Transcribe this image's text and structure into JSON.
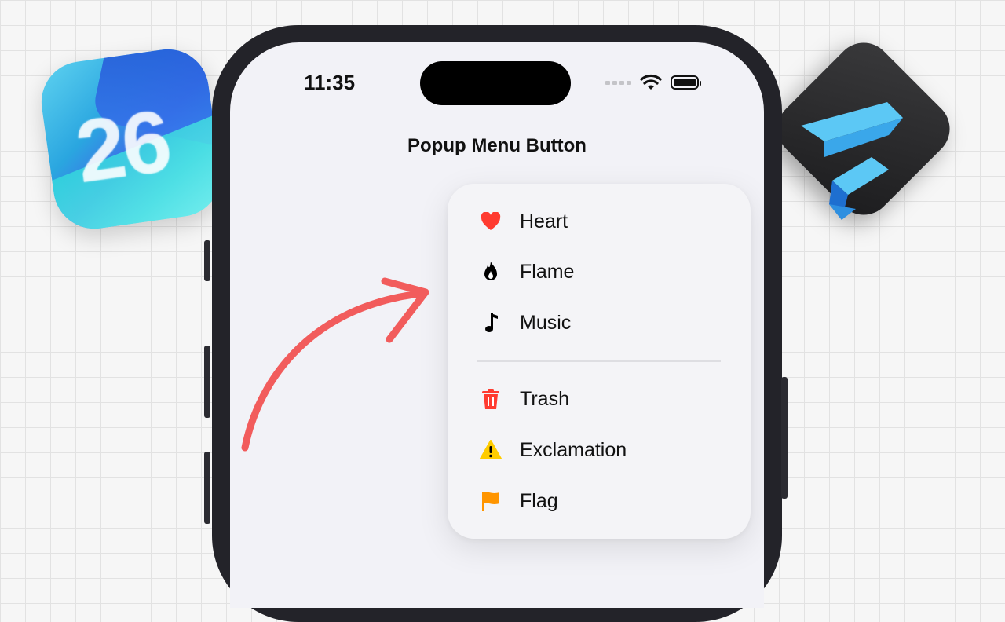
{
  "status_bar": {
    "time": "11:35"
  },
  "nav": {
    "title": "Popup Menu Button"
  },
  "app_icons": {
    "left_badge": "26"
  },
  "menu": {
    "items": [
      {
        "label": "Heart",
        "icon": "heart-icon",
        "color": "#ff3b30"
      },
      {
        "label": "Flame",
        "icon": "flame-icon",
        "color": "#000000"
      },
      {
        "label": "Music",
        "icon": "music-note-icon",
        "color": "#000000"
      },
      {
        "label": "Trash",
        "icon": "trash-icon",
        "color": "#ff3b30"
      },
      {
        "label": "Exclamation",
        "icon": "warning-triangle-icon",
        "color": "#ffcc00"
      },
      {
        "label": "Flag",
        "icon": "flag-icon",
        "color": "#ff9500"
      }
    ]
  },
  "colors": {
    "arrow": "#f25c5c",
    "background": "#f6f6f6"
  }
}
